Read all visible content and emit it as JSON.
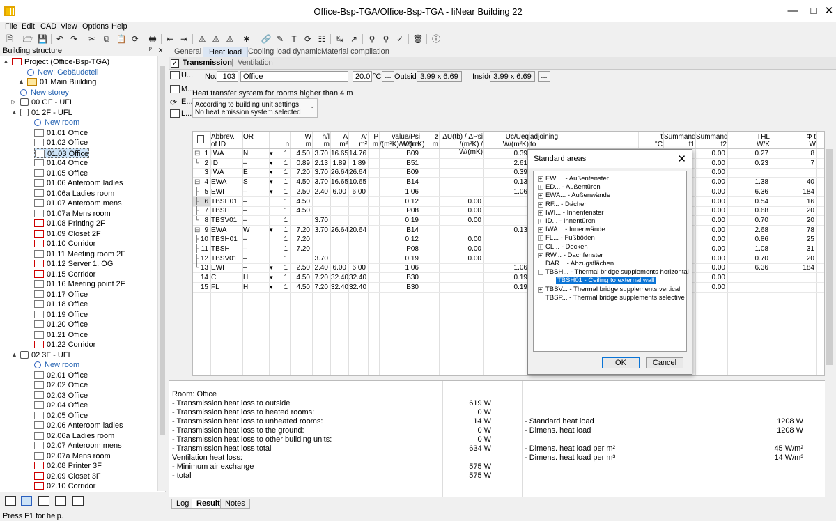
{
  "window": {
    "title": "Office-Bsp-TGA/Office-Bsp-TGA - liNear Building 22"
  },
  "menu": [
    "File",
    "Edit",
    "CAD",
    "View",
    "Options",
    "Help"
  ],
  "left_panel": {
    "title": "Building structure",
    "pin": "ᵖ",
    "close": "×",
    "tree": [
      {
        "label": "Project (Office-Bsp-TGA)",
        "icon": "project",
        "level": 0,
        "exp": "▲"
      },
      {
        "label": "New: Gebäudeteil",
        "icon": "add",
        "level": 1,
        "blue": true
      },
      {
        "label": "01 Main Building",
        "icon": "building",
        "level": 1,
        "exp": "▲"
      },
      {
        "label": "New storey",
        "icon": "add",
        "level": 2,
        "blue": true
      },
      {
        "label": "00 GF - UFL",
        "icon": "floor-red",
        "level": 2,
        "exp": "▷"
      },
      {
        "label": "01 2F - UFL",
        "icon": "floor",
        "level": 2,
        "exp": "▲"
      },
      {
        "label": "New room",
        "icon": "add",
        "level": 3,
        "blue": true
      },
      {
        "label": "01.01 Office",
        "icon": "room",
        "level": 3
      },
      {
        "label": "01.02 Office",
        "icon": "room",
        "level": 3
      },
      {
        "label": "01.03 Office",
        "icon": "room",
        "level": 3,
        "selected": true
      },
      {
        "label": "01.04 Office",
        "icon": "room",
        "level": 3
      },
      {
        "label": "01.05 Office",
        "icon": "room",
        "level": 3
      },
      {
        "label": "01.06 Anteroom ladies",
        "icon": "room",
        "level": 3
      },
      {
        "label": "01.06a Ladies room",
        "icon": "room",
        "level": 3
      },
      {
        "label": "01.07 Anteroom mens",
        "icon": "room",
        "level": 3
      },
      {
        "label": "01.07a Mens room",
        "icon": "room",
        "level": 3
      },
      {
        "label": "01.08 Printing 2F",
        "icon": "room-red",
        "level": 3
      },
      {
        "label": "01.09 Closet 2F",
        "icon": "room-red",
        "level": 3
      },
      {
        "label": "01.10 Corridor",
        "icon": "room-red",
        "level": 3
      },
      {
        "label": "01.11 Meeting room 2F",
        "icon": "room",
        "level": 3
      },
      {
        "label": "01.12 Server 1. OG",
        "icon": "room-red",
        "level": 3
      },
      {
        "label": "01.15 Corridor",
        "icon": "room-red",
        "level": 3
      },
      {
        "label": "01.16 Meeting point 2F",
        "icon": "room",
        "level": 3
      },
      {
        "label": "01.17 Office",
        "icon": "room",
        "level": 3
      },
      {
        "label": "01.18 Office",
        "icon": "room",
        "level": 3
      },
      {
        "label": "01.19 Office",
        "icon": "room",
        "level": 3
      },
      {
        "label": "01.20 Office",
        "icon": "room",
        "level": 3
      },
      {
        "label": "01.21 Office",
        "icon": "room",
        "level": 3
      },
      {
        "label": "01.22 Corridor",
        "icon": "room-red",
        "level": 3
      },
      {
        "label": "02 3F - UFL",
        "icon": "floor",
        "level": 2,
        "exp": "▲"
      },
      {
        "label": "New room",
        "icon": "add",
        "level": 3,
        "blue": true
      },
      {
        "label": "02.01 Office",
        "icon": "room",
        "level": 3
      },
      {
        "label": "02.02 Office",
        "icon": "room",
        "level": 3
      },
      {
        "label": "02.03 Office",
        "icon": "room",
        "level": 3
      },
      {
        "label": "02.04 Office",
        "icon": "room",
        "level": 3
      },
      {
        "label": "02.05 Office",
        "icon": "room",
        "level": 3
      },
      {
        "label": "02.06 Anteroom ladies",
        "icon": "room",
        "level": 3
      },
      {
        "label": "02.06a Ladies room",
        "icon": "room",
        "level": 3
      },
      {
        "label": "02.07 Anteroom mens",
        "icon": "room",
        "level": 3
      },
      {
        "label": "02.07a Mens room",
        "icon": "room",
        "level": 3
      },
      {
        "label": "02.08 Printer 3F",
        "icon": "room-red",
        "level": 3
      },
      {
        "label": "02.09 Closet 3F",
        "icon": "room-red",
        "level": 3
      },
      {
        "label": "02.10 Corridor",
        "icon": "room-red",
        "level": 3
      }
    ]
  },
  "tabs": [
    "General",
    "Heat load",
    "Cooling load dynamic",
    "Material compilation"
  ],
  "active_tab": "Heat load",
  "section": {
    "transmission": "Transmission",
    "sep": "|",
    "ventilation": "Ventilation",
    "checked_mark": "✓"
  },
  "side_tabs": [
    "U...",
    "M...",
    "E...",
    "L..."
  ],
  "room": {
    "no_label": "No.",
    "no": "103",
    "name": "Office",
    "temp": "20.0",
    "temp_unit": "°C",
    "dots": "...",
    "outside_label": "Outside",
    "outside": "3.99 x 6.69",
    "inside_label": "Inside",
    "inside": "3.99 x 6.69",
    "hts_label": "Heat transfer system for rooms higher than 4 m",
    "hts_line1": "According to building unit settings",
    "hts_line2": "No heat emission system selected",
    "hts_arrow": "⌄"
  },
  "grid": {
    "headers": [
      {
        "l1": "Abbrev.",
        "l2": "of ID"
      },
      {
        "l1": "OR",
        "l2": ""
      },
      {
        "l1": "",
        "l2": "n"
      },
      {
        "l1": "W",
        "l2": "m"
      },
      {
        "l1": "h/l",
        "l2": "m"
      },
      {
        "l1": "A",
        "l2": "m²"
      },
      {
        "l1": "A'",
        "l2": "m²"
      },
      {
        "l1": "P",
        "l2": "m"
      },
      {
        "l1": "value/Psi value",
        "l2": "/(m²K)/W/(mK)"
      },
      {
        "l1": "z",
        "l2": "m"
      },
      {
        "l1": "ΔU(tb) / ΔPsi",
        "l2": "/(m²K) / W/(mK)"
      },
      {
        "l1": "Uc/Ueq",
        "l2": "W/(m²K)"
      },
      {
        "l1": "adjoining",
        "l2": "to"
      },
      {
        "l1": "t",
        "l2": "°C"
      },
      {
        "l1": "Summand",
        "l2": "f1"
      },
      {
        "l1": "Summand",
        "l2": "f2"
      },
      {
        "l1": "THL",
        "l2": "W/K"
      },
      {
        "l1": "Φ t",
        "l2": "W"
      }
    ],
    "rows": [
      {
        "num": "1",
        "tree": "⊟",
        "id": "IWA",
        "or": "N",
        "dd": "▾",
        "n": "1",
        "w": "4.50",
        "h": "3.70",
        "a": "16.65",
        "ap": "14.76",
        "p": "",
        "u": "B09",
        "z": "",
        "du": "",
        "uc": "0.39",
        "f2": "0.00",
        "thl": "0.27",
        "phi": "8"
      },
      {
        "num": "2",
        "tree": "└",
        "id": "ID",
        "or": "–",
        "dd": "▾",
        "n": "1",
        "w": "0.89",
        "h": "2.13",
        "a": "1.89",
        "ap": "1.89",
        "p": "",
        "u": "B51",
        "z": "",
        "du": "",
        "uc": "2.61",
        "f2": "0.00",
        "thl": "0.23",
        "phi": "7"
      },
      {
        "num": "3",
        "tree": "",
        "id": "IWA",
        "or": "E",
        "dd": "▾",
        "n": "1",
        "w": "7.20",
        "h": "3.70",
        "a": "26.64",
        "ap": "26.64",
        "p": "",
        "u": "B09",
        "z": "",
        "du": "",
        "uc": "0.39",
        "f2": "0.00",
        "thl": "",
        "phi": ""
      },
      {
        "num": "4",
        "tree": "⊟",
        "id": "EWA",
        "or": "S",
        "dd": "▾",
        "n": "1",
        "w": "4.50",
        "h": "3.70",
        "a": "16.65",
        "ap": "10.65",
        "p": "",
        "u": "B14",
        "z": "",
        "du": "",
        "uc": "0.13",
        "f2": "0.00",
        "thl": "1.38",
        "phi": "40"
      },
      {
        "num": "5",
        "tree": "├",
        "id": "EWI",
        "or": "–",
        "dd": "▾",
        "n": "1",
        "w": "2.50",
        "h": "2.40",
        "a": "6.00",
        "ap": "6.00",
        "p": "",
        "u": "1.06",
        "z": "",
        "du": "",
        "uc": "1.06",
        "f2": "0.00",
        "thl": "6.36",
        "phi": "184"
      },
      {
        "num": "6",
        "tree": "├",
        "id": "TBSH01",
        "or": "–",
        "dd": "",
        "n": "1",
        "w": "4.50",
        "h": "",
        "a": "",
        "ap": "",
        "p": "",
        "u": "0.12",
        "z": "",
        "du": "0.00",
        "uc": "",
        "f2": "0.00",
        "thl": "0.54",
        "phi": "16",
        "hl": true
      },
      {
        "num": "7",
        "tree": "├",
        "id": "TBSH",
        "or": "–",
        "dd": "",
        "n": "1",
        "w": "4.50",
        "h": "",
        "a": "",
        "ap": "",
        "p": "",
        "u": "P08",
        "z": "",
        "du": "0.00",
        "uc": "",
        "f2": "0.00",
        "thl": "0.68",
        "phi": "20"
      },
      {
        "num": "8",
        "tree": "└",
        "id": "TBSV01",
        "or": "–",
        "dd": "",
        "n": "1",
        "w": "",
        "h": "3.70",
        "a": "",
        "ap": "",
        "p": "",
        "u": "0.19",
        "z": "",
        "du": "0.00",
        "uc": "",
        "f2": "0.00",
        "thl": "0.70",
        "phi": "20"
      },
      {
        "num": "9",
        "tree": "⊟",
        "id": "EWA",
        "or": "W",
        "dd": "▾",
        "n": "1",
        "w": "7.20",
        "h": "3.70",
        "a": "26.64",
        "ap": "20.64",
        "p": "",
        "u": "B14",
        "z": "",
        "du": "",
        "uc": "0.13",
        "f2": "0.00",
        "thl": "2.68",
        "phi": "78"
      },
      {
        "num": "10",
        "tree": "├",
        "id": "TBSH01",
        "or": "–",
        "dd": "",
        "n": "1",
        "w": "7.20",
        "h": "",
        "a": "",
        "ap": "",
        "p": "",
        "u": "0.12",
        "z": "",
        "du": "0.00",
        "uc": "",
        "f2": "0.00",
        "thl": "0.86",
        "phi": "25"
      },
      {
        "num": "11",
        "tree": "├",
        "id": "TBSH",
        "or": "–",
        "dd": "",
        "n": "1",
        "w": "7.20",
        "h": "",
        "a": "",
        "ap": "",
        "p": "",
        "u": "P08",
        "z": "",
        "du": "0.00",
        "uc": "",
        "f2": "0.00",
        "thl": "1.08",
        "phi": "31"
      },
      {
        "num": "12",
        "tree": "├",
        "id": "TBSV01",
        "or": "–",
        "dd": "",
        "n": "1",
        "w": "",
        "h": "3.70",
        "a": "",
        "ap": "",
        "p": "",
        "u": "0.19",
        "z": "",
        "du": "0.00",
        "uc": "",
        "f2": "0.00",
        "thl": "0.70",
        "phi": "20"
      },
      {
        "num": "13",
        "tree": "└",
        "id": "EWI",
        "or": "–",
        "dd": "▾",
        "n": "1",
        "w": "2.50",
        "h": "2.40",
        "a": "6.00",
        "ap": "6.00",
        "p": "",
        "u": "1.06",
        "z": "",
        "du": "",
        "uc": "1.06",
        "f2": "0.00",
        "thl": "6.36",
        "phi": "184"
      },
      {
        "num": "14",
        "tree": "",
        "id": "CL",
        "or": "H",
        "dd": "▾",
        "n": "1",
        "w": "4.50",
        "h": "7.20",
        "a": "32.40",
        "ap": "32.40",
        "p": "",
        "u": "B30",
        "z": "",
        "du": "",
        "uc": "0.19",
        "f2": "0.00",
        "thl": "",
        "phi": ""
      },
      {
        "num": "15",
        "tree": "",
        "id": "FL",
        "or": "H",
        "dd": "▾",
        "n": "1",
        "w": "4.50",
        "h": "7.20",
        "a": "32.40",
        "ap": "32.40",
        "p": "",
        "u": "B30",
        "z": "",
        "du": "",
        "uc": "0.19",
        "f2": "0.00",
        "thl": "",
        "phi": ""
      }
    ]
  },
  "dialog": {
    "title": "Standard areas",
    "close": "✕",
    "nodes": [
      {
        "label": "EWI... - Außenfenster",
        "exp": "+"
      },
      {
        "label": "ED... - Außentüren",
        "exp": "+"
      },
      {
        "label": "EWA... - Außenwände",
        "exp": "+"
      },
      {
        "label": "RF... - Dächer",
        "exp": "+"
      },
      {
        "label": "IWI... - Innenfenster",
        "exp": "+"
      },
      {
        "label": "ID... - Innentüren",
        "exp": "+"
      },
      {
        "label": "IWA... - Innenwände",
        "exp": "+"
      },
      {
        "label": "FL... - Fußböden",
        "exp": "+"
      },
      {
        "label": "CL... - Decken",
        "exp": "+"
      },
      {
        "label": "RW... - Dachfenster",
        "exp": "+"
      },
      {
        "label": "DAR... - Abzugsflächen",
        "exp": ""
      },
      {
        "label": "TBSH... - Thermal bridge supplements horizontal",
        "exp": "−"
      },
      {
        "label": "TBSH01 - Ceiling to external wall",
        "exp": "",
        "child": true,
        "selected": true
      },
      {
        "label": "TBSV... - Thermal bridge supplements vertical",
        "exp": "+"
      },
      {
        "label": "TBSP... - Thermal bridge supplements selective",
        "exp": ""
      }
    ],
    "ok": "OK",
    "cancel": "Cancel"
  },
  "results": {
    "left": [
      {
        "label": "Room: Office",
        "value": ""
      },
      {
        "label": "- Transmission heat loss to outside",
        "value": "619 W"
      },
      {
        "label": "- Transmission heat loss to heated rooms:",
        "value": "0 W"
      },
      {
        "label": "- Transmission heat loss to unheated rooms:",
        "value": "14 W"
      },
      {
        "label": "- Transmission heat loss to the ground:",
        "value": "0 W"
      },
      {
        "label": "- Transmission heat loss to other building units:",
        "value": "0 W"
      },
      {
        "label": "- Transmission heat loss total",
        "value": "634 W"
      },
      {
        "label": "Ventilation heat loss:",
        "value": ""
      },
      {
        "label": "- Minimum air exchange",
        "value": "575 W"
      },
      {
        "label": "- total",
        "value": "575 W"
      }
    ],
    "right": [
      {
        "label": "- Standard heat load",
        "value": "1208 W",
        "row": 3
      },
      {
        "label": "- Dimens. heat load",
        "value": "1208 W",
        "row": 4
      },
      {
        "label": "- Dimens. heat load per m²",
        "value": "45 W/m²",
        "row": 6
      },
      {
        "label": "- Dimens. heat load per m³",
        "value": "14 W/m³",
        "row": 7
      }
    ]
  },
  "bottom_tabs": [
    "Log",
    "Results",
    "Notes"
  ],
  "status": "Press F1 for help."
}
